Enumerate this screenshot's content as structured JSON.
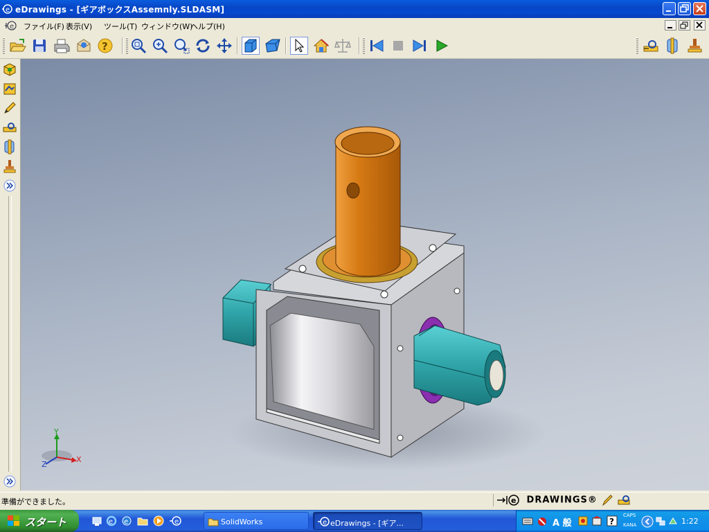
{
  "window": {
    "title": "eDrawings - [ギアボックスAssemnly.SLDASM]",
    "app_icon": "edrawings-app-icon"
  },
  "menu": {
    "items": [
      {
        "label": "ファイル(F)"
      },
      {
        "label": "表示(V)"
      },
      {
        "label": "ツール(T)"
      },
      {
        "label": "ウィンドウ(W)"
      },
      {
        "label": "ヘルプ(H)"
      }
    ]
  },
  "toolbar": {
    "icons": [
      "open-icon",
      "save-icon",
      "print-icon",
      "send-mail-icon",
      "help-icon",
      "zoom-to-fit-icon",
      "zoom-in-out-icon",
      "zoom-to-area-icon",
      "rotate-icon",
      "pan-icon",
      "shaded-view-icon",
      "perspective-icon",
      "select-icon",
      "home-view-icon",
      "measure-icon",
      "first-frame-icon",
      "stop-icon",
      "next-frame-icon",
      "play-icon",
      "markup-dimension-icon",
      "cross-section-icon",
      "stamp-icon"
    ]
  },
  "left_toolbar": {
    "icons": [
      "components-icon",
      "configurations-icon",
      "markup-pen-icon",
      "dimension-icon",
      "cross-section-icon",
      "stamp-icon",
      "expand-icon",
      "expand-bottom-icon"
    ]
  },
  "viewport": {
    "triad": {
      "x_label": "X",
      "y_label": "Y",
      "z_label": "Z"
    },
    "colors": {
      "shaft": "#d67a14",
      "housing": "#c8c9ce",
      "hex_shaft": "#2fa4a8",
      "seal": "#8a2fb0"
    }
  },
  "status": {
    "message": "準備ができました。",
    "brand": "DRAWINGS®"
  },
  "taskbar": {
    "start_label": "スタート",
    "buttons": [
      {
        "label": "SolidWorks"
      },
      {
        "label": "eDrawings - [ギア..."
      }
    ],
    "tray": {
      "ime": "A 般",
      "caps": "CAPS",
      "kana": "KANA",
      "clock": "1:22"
    }
  }
}
